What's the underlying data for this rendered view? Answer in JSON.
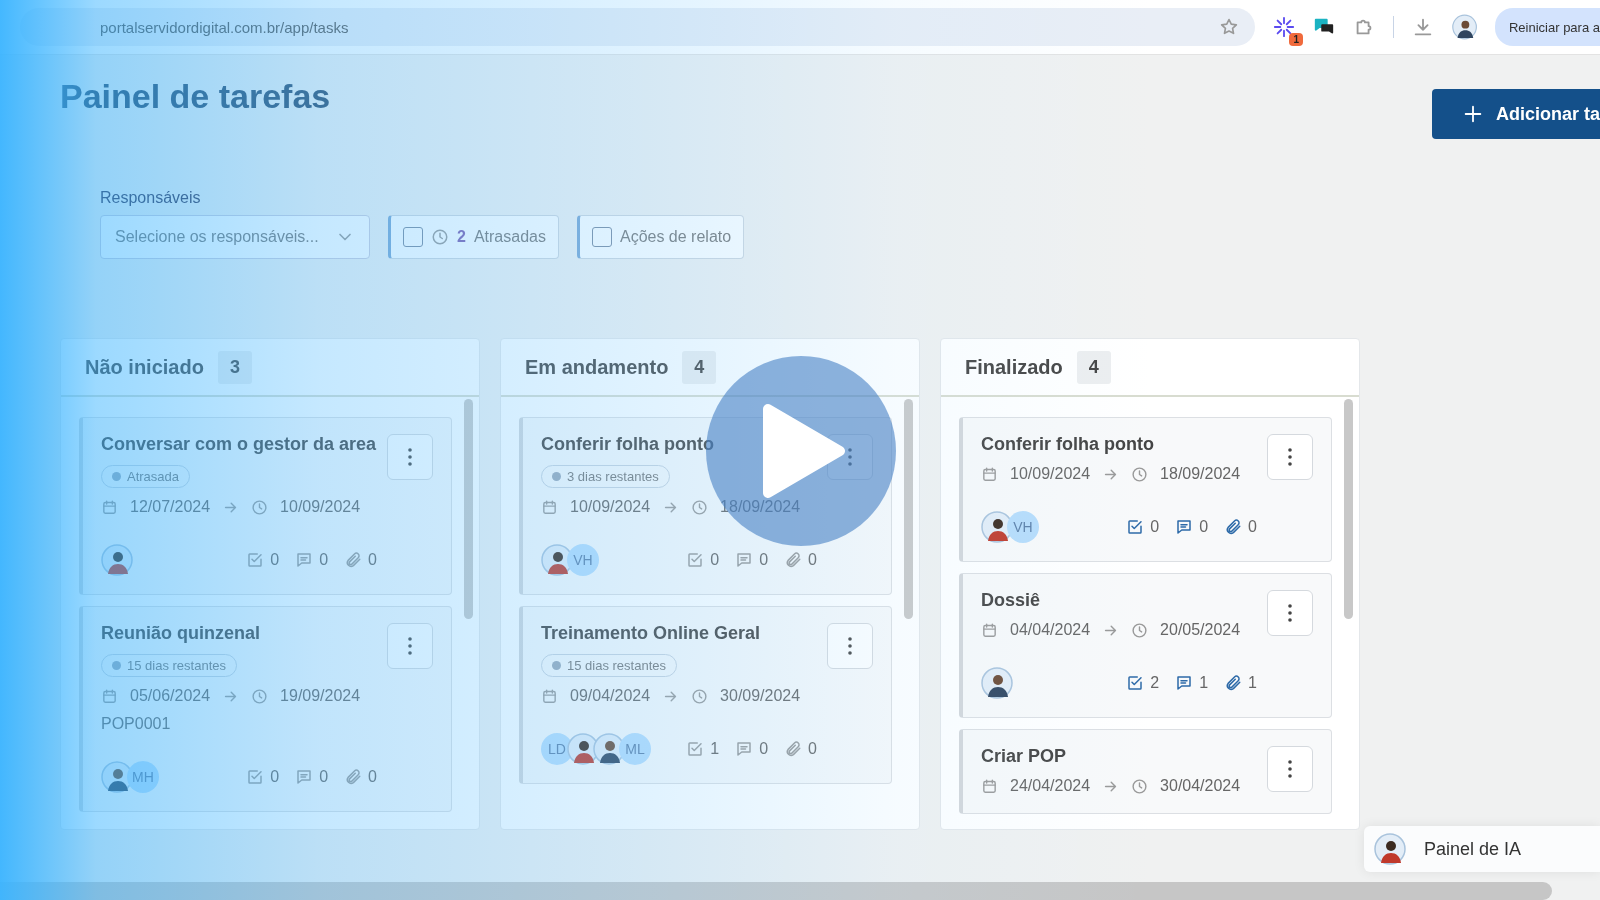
{
  "browser": {
    "url": "portalservidordigital.com.br/app/tasks",
    "extension_badge": "1",
    "restart_button": "Reiniciar para a"
  },
  "page": {
    "title": "Painel de tarefas",
    "add_button": "Adicionar ta"
  },
  "filters": {
    "label": "Responsáveis",
    "select_placeholder": "Selecione os responsáveis...",
    "chips": [
      {
        "kind": "late",
        "count": "2",
        "label": "Atrasadas",
        "checked": false
      },
      {
        "kind": "plain",
        "label": "Ações de relato",
        "checked": false
      }
    ]
  },
  "columns": [
    {
      "title": "Não iniciado",
      "count": "3",
      "cards": [
        {
          "title": "Conversar com o gestor da area",
          "badge": "Atrasada",
          "start": "12/07/2024",
          "end": "10/09/2024",
          "assignees": [
            {
              "kind": "photo"
            }
          ],
          "checklist": "0",
          "comments": "0",
          "attachments": "0"
        },
        {
          "title": "Reunião quinzenal",
          "badge": "15 dias restantes",
          "start": "05/06/2024",
          "end": "19/09/2024",
          "tag": "POP0001",
          "assignees": [
            {
              "kind": "photo"
            },
            {
              "kind": "initials",
              "initials": "MH"
            }
          ],
          "checklist": "0",
          "comments": "0",
          "attachments": "0"
        }
      ]
    },
    {
      "title": "Em andamento",
      "count": "4",
      "cards": [
        {
          "title": "Conferir folha ponto",
          "badge": "3 dias restantes",
          "start": "10/09/2024",
          "end": "18/09/2024",
          "assignees": [
            {
              "kind": "photo"
            },
            {
              "kind": "initials",
              "initials": "VH"
            }
          ],
          "checklist": "0",
          "comments": "0",
          "attachments": "0"
        },
        {
          "title": "Treinamento Online Geral",
          "badge": "15 dias restantes",
          "start": "09/04/2024",
          "end": "30/09/2024",
          "assignees": [
            {
              "kind": "initials",
              "initials": "LD"
            },
            {
              "kind": "photo"
            },
            {
              "kind": "photo"
            },
            {
              "kind": "initials",
              "initials": "ML"
            }
          ],
          "checklist": "1",
          "comments": "0",
          "attachments": "0"
        }
      ]
    },
    {
      "title": "Finalizado",
      "count": "4",
      "cards": [
        {
          "title": "Conferir folha ponto",
          "start": "10/09/2024",
          "end": "18/09/2024",
          "assignees": [
            {
              "kind": "photo"
            },
            {
              "kind": "initials",
              "initials": "VH"
            }
          ],
          "checklist": "0",
          "comments": "0",
          "attachments": "0"
        },
        {
          "title": "Dossiê",
          "start": "04/04/2024",
          "end": "20/05/2024",
          "assignees": [
            {
              "kind": "photo"
            }
          ],
          "checklist": "2",
          "comments": "1",
          "attachments": "1"
        },
        {
          "title": "Criar POP",
          "start": "24/04/2024",
          "end": "30/04/2024"
        }
      ]
    }
  ],
  "ai_panel": {
    "label": "Painel de IA"
  }
}
